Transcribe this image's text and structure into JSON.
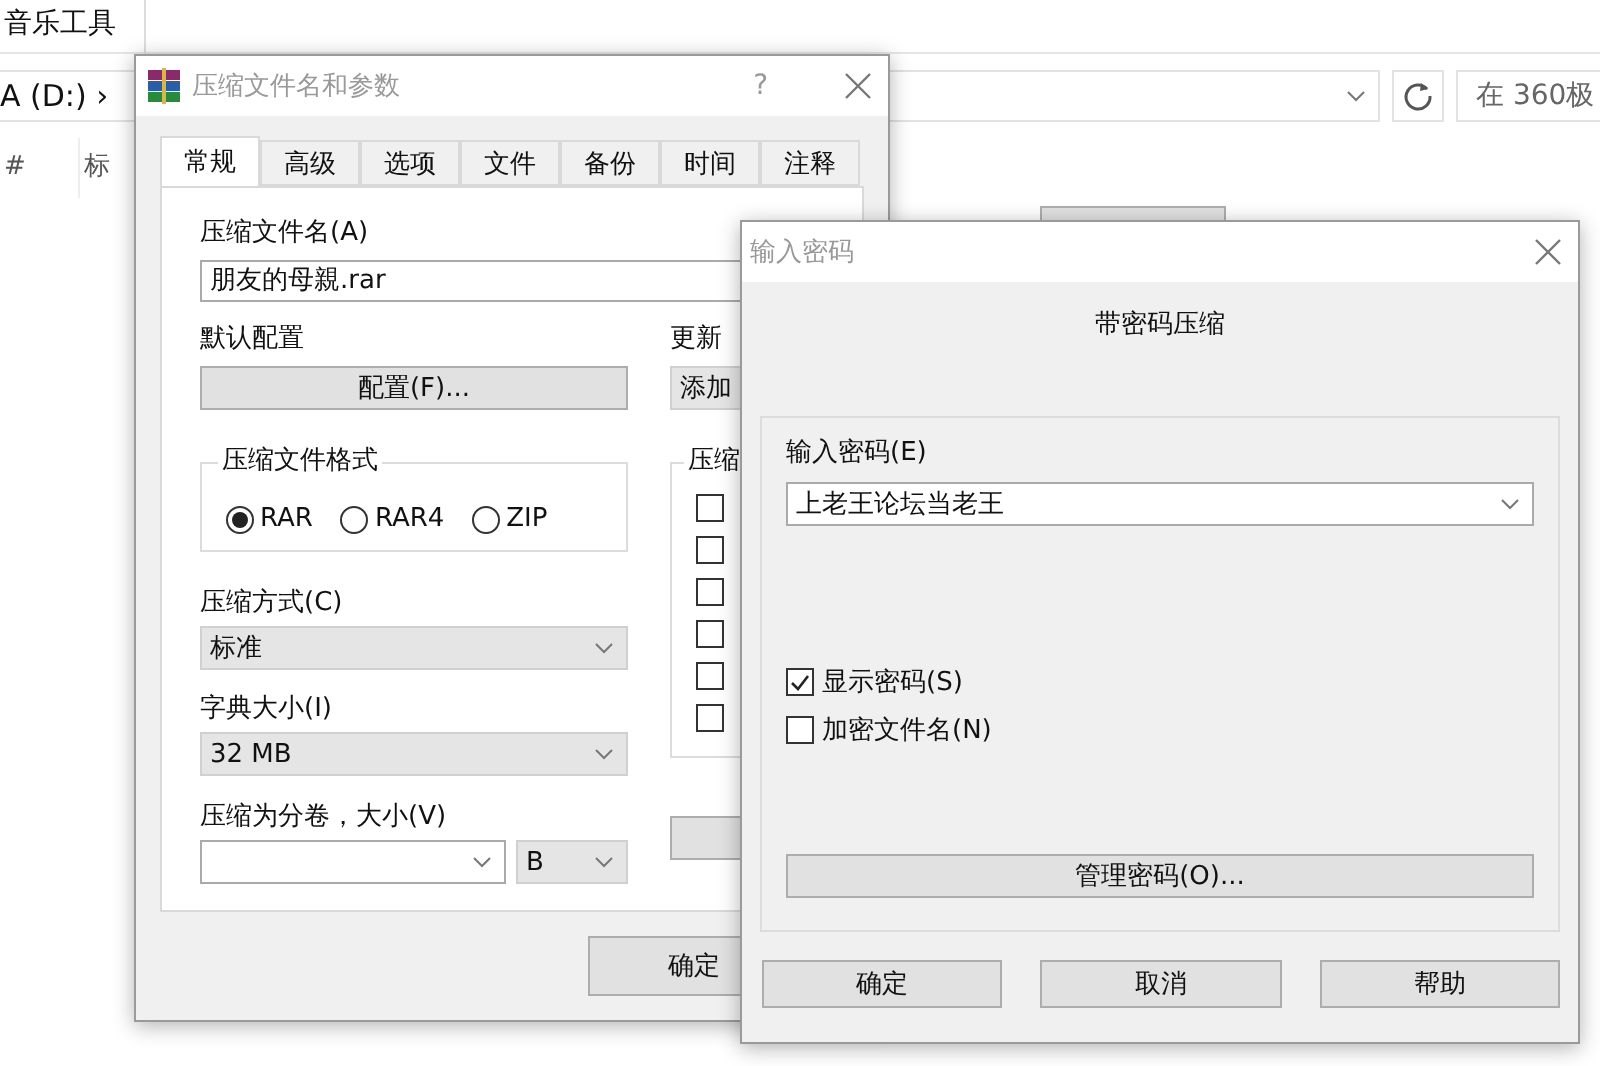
{
  "explorer": {
    "ribbon_tab": "音乐工具",
    "address": "A (D:)",
    "address_separator": "›",
    "search_placeholder": "在 360极",
    "columns": [
      "#",
      "标"
    ]
  },
  "archive_dialog": {
    "title": "压缩文件名和参数",
    "help": "?",
    "tabs": [
      {
        "label": "常规",
        "selected": true
      },
      {
        "label": "高级",
        "selected": false
      },
      {
        "label": "选项",
        "selected": false
      },
      {
        "label": "文件",
        "selected": false
      },
      {
        "label": "备份",
        "selected": false
      },
      {
        "label": "时间",
        "selected": false
      },
      {
        "label": "注释",
        "selected": false
      }
    ],
    "archive_name_label": "压缩文件名(A)",
    "archive_name": "朋友的母親.rar",
    "profile_label": "默认配置",
    "profile_button": "配置(F)...",
    "update_label": "更新",
    "update_value": "添加",
    "format_label": "压缩文件格式",
    "formats": [
      {
        "label": "RAR",
        "selected": true
      },
      {
        "label": "RAR4",
        "selected": false
      },
      {
        "label": "ZIP",
        "selected": false
      }
    ],
    "method_label": "压缩方式(C)",
    "method": "标准",
    "dict_label": "字典大小(I)",
    "dict": "32 MB",
    "volume_label": "压缩为分卷，大小(V)",
    "volume_unit": "B",
    "options_label": "压缩",
    "options": [
      {
        "checked": false
      },
      {
        "checked": false
      },
      {
        "checked": false
      },
      {
        "checked": false
      },
      {
        "checked": false
      },
      {
        "checked": false
      }
    ],
    "ok_button": "确定"
  },
  "password_dialog": {
    "title": "输入密码",
    "subtitle": "带密码压缩",
    "password_label": "输入密码(E)",
    "password": "上老王论坛当老王",
    "options": [
      {
        "label": "显示密码(S)",
        "checked": true
      },
      {
        "label": "加密文件名(N)",
        "checked": false
      }
    ],
    "manage_button": "管理密码(O)...",
    "buttons": [
      "确定",
      "取消",
      "帮助"
    ]
  }
}
